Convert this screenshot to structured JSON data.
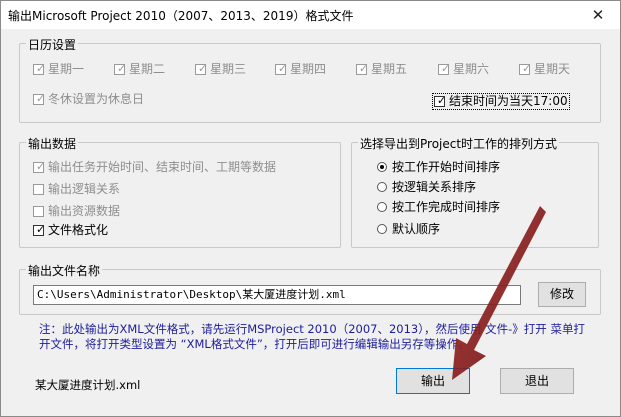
{
  "window": {
    "title": "输出Microsoft Project 2010（2007、2013、2019）格式文件",
    "close_label": "✕"
  },
  "calendar": {
    "legend": "日历设置",
    "weekdays": [
      {
        "label": "星期一",
        "checked": true
      },
      {
        "label": "星期二",
        "checked": true
      },
      {
        "label": "星期三",
        "checked": true
      },
      {
        "label": "星期四",
        "checked": true
      },
      {
        "label": "星期五",
        "checked": true
      },
      {
        "label": "星期六",
        "checked": true
      },
      {
        "label": "星期天",
        "checked": true
      }
    ],
    "winter_holiday_label": "冬休设置为休息日",
    "end_time_label": "结束时间为当天17:00"
  },
  "output_data": {
    "legend": "输出数据",
    "items": [
      {
        "label": "输出任务开始时间、结束时间、工期等数据",
        "checked": true,
        "enabled": false
      },
      {
        "label": "输出逻辑关系",
        "checked": false,
        "enabled": false
      },
      {
        "label": "输出资源数据",
        "checked": false,
        "enabled": false
      },
      {
        "label": "文件格式化",
        "checked": true,
        "enabled": true
      }
    ]
  },
  "sort": {
    "legend": "选择导出到Project时工作的排列方式",
    "options": [
      {
        "label": "按工作开始时间排序",
        "selected": true
      },
      {
        "label": "按逻辑关系排序",
        "selected": false
      },
      {
        "label": "按工作完成时间排序",
        "selected": false
      },
      {
        "label": "默认顺序",
        "selected": false
      }
    ]
  },
  "filename": {
    "legend": "输出文件名称",
    "path": "C:\\Users\\Administrator\\Desktop\\某大厦进度计划.xml",
    "modify_label": "修改"
  },
  "note": "注：此处输出为XML文件格式，请先运行MSProject 2010（2007、2013），然后使用 文件-》打开 菜单打开文件，将打开类型设置为 “XML格式文件”，打开后即可进行编辑输出另存等操作。",
  "footer": {
    "file_name": "某大厦进度计划.xml",
    "output_label": "输出",
    "exit_label": "退出"
  },
  "colors": {
    "note_text": "#1d1d9a",
    "arrow": "#8b1a1a"
  }
}
